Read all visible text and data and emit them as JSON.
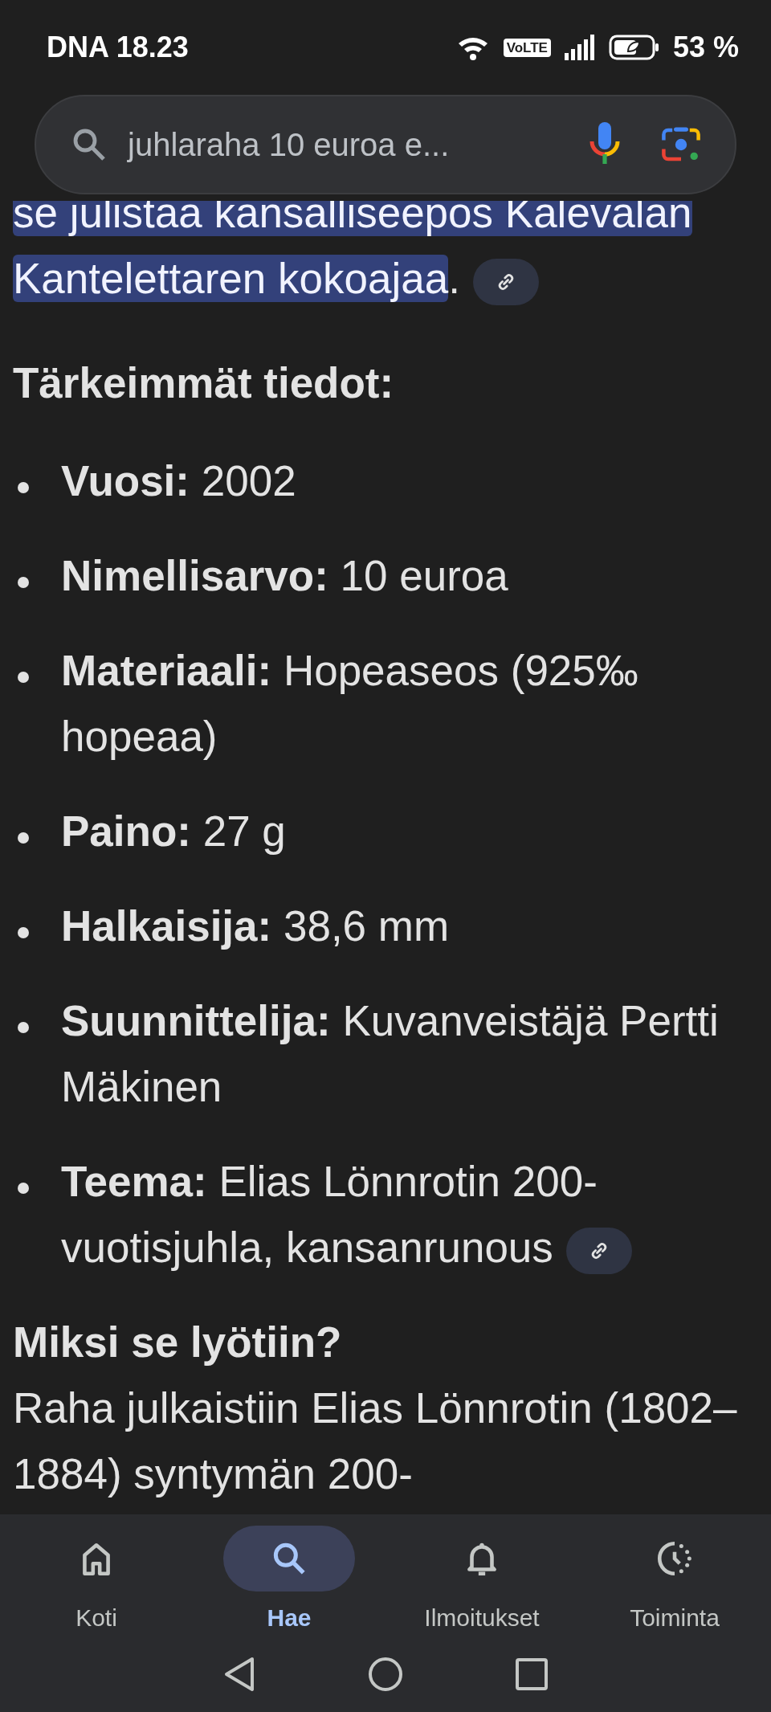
{
  "status_bar": {
    "carrier_time": "DNA 18.23",
    "network_badge": "VoLTE",
    "battery": "53 %"
  },
  "search": {
    "value": "juhlaraha 10 euroa e..."
  },
  "intro": {
    "highlighted_lines": [
      "se julistaa kansalliseepos Kalevalan",
      "Kantelettaren kokoajaa"
    ],
    "tail": ".",
    "link": true
  },
  "facts_heading": "Tärkeimmät tiedot:",
  "facts": [
    {
      "label": "Vuosi:",
      "value": "2002",
      "link": false
    },
    {
      "label": "Nimellisarvo:",
      "value": "10 euroa",
      "link": false
    },
    {
      "label": "Materiaali:",
      "value": "Hopeaseos (925‰ hopeaa)",
      "link": false
    },
    {
      "label": "Paino:",
      "value": "27 g",
      "link": false
    },
    {
      "label": "Halkaisija:",
      "value": "38,6 mm",
      "link": false
    },
    {
      "label": "Suunnittelija:",
      "value": "Kuvanveistäjä Pertti Mäkinen",
      "link": false
    },
    {
      "label": "Teema:",
      "value": "Elias Lönnrotin 200-vuotisjuhla, kansanrunous",
      "link": true
    }
  ],
  "why_heading": "Miksi se lyötiin?",
  "why_text": "Raha julkaistiin Elias Lönnrotin (1802–1884) syntymän 200-",
  "bottom_nav": [
    {
      "kind": "home",
      "label": "Koti",
      "selected": false
    },
    {
      "kind": "search",
      "label": "Hae",
      "selected": true
    },
    {
      "kind": "bell",
      "label": "Ilmoitukset",
      "selected": false
    },
    {
      "kind": "activity",
      "label": "Toiminta",
      "selected": false
    }
  ]
}
